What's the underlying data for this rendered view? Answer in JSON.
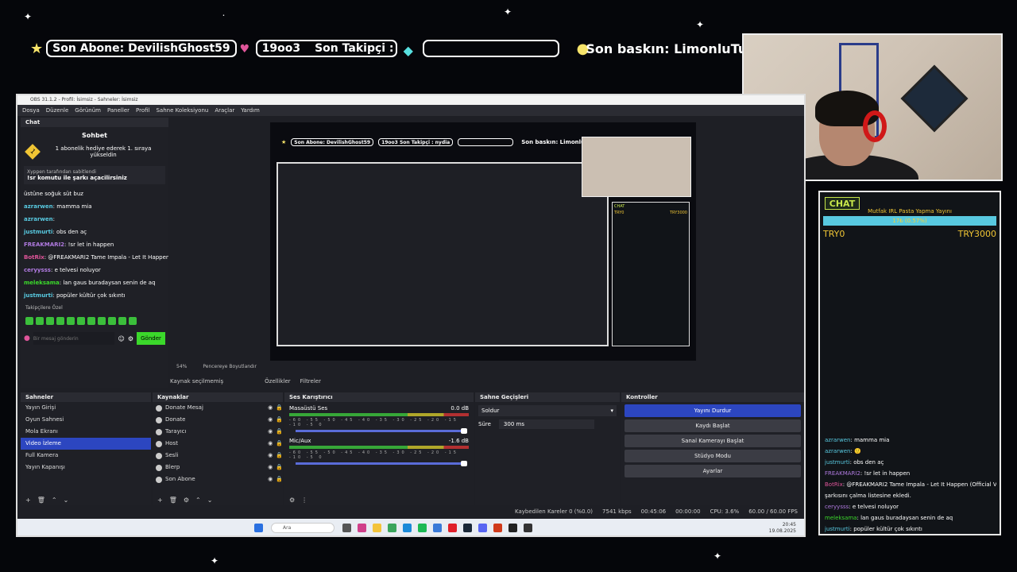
{
  "ticker": {
    "last_sub": "Son Abone: DevilishGhost59",
    "pill_2": "19oo3",
    "last_follower": "Son Takipçi : nydia",
    "empty_pill": "",
    "last_raid": "Son baskın: LimonluTurta"
  },
  "chat_overlay": {
    "label": "CHAT",
    "goal_title": "Mutfak IRL Pasta Yapma Yayını",
    "goal_progress_text": "17₺ (0.57%)",
    "goal_progress_pct": 0.57,
    "goal_min": "TRY0",
    "goal_max": "TRY3000",
    "messages": [
      {
        "user": "azrarwen",
        "text": ": mamma mia"
      },
      {
        "user": "azrarwen",
        "text": ": 🙂"
      },
      {
        "user": "justmurti",
        "text": ": obs den aç"
      },
      {
        "user": "FREAKMARI2",
        "text": ": !sr let in happen"
      },
      {
        "user": "BotRix",
        "text": ": @FREAKMARI2 Tame Impala - Let It Happen (Official Video)"
      },
      {
        "user": "",
        "text": "şarkısını çalma listesine ekledi."
      },
      {
        "user": "ceryysss",
        "text": ": e telvesi noluyor"
      },
      {
        "user": "meleksama",
        "text": ": lan gaus buradaysan senin de aq"
      },
      {
        "user": "justmurti",
        "text": ": popüler kültür çok sıkıntı"
      }
    ]
  },
  "obs": {
    "title": "OBS 31.1.2 - Profil: İsimsiz - Sahneler: İsimsiz",
    "menu": [
      "Dosya",
      "Düzenle",
      "Görünüm",
      "Paneller",
      "Profil",
      "Sahne Koleksiyonu",
      "Araçlar",
      "Yardım"
    ],
    "chat_dock": {
      "title": "Chat",
      "heading": "Sohbet",
      "gift_banner": "1 abonelik hediye ederek 1. sıraya yükseldin",
      "pinned_by": "Xyppen tarafından sabitlendi",
      "pinned_text": "!sr komutu ile şarkı açacilirsiniz",
      "messages": [
        {
          "user": "",
          "text": "üstüne soğuk süt buz"
        },
        {
          "user": "azrarwen",
          "text": ": mamma mia"
        },
        {
          "user": "azrarwen",
          "text": ":"
        },
        {
          "user": "justmurti",
          "text": ": obs den aç"
        },
        {
          "user": "FREAKMARI2",
          "text": ": !sr let in happen"
        },
        {
          "user": "BotRix",
          "text": ": @FREAKMARI2 Tame Impala - Let It Happen (Official Video) şarkısını çalma listesine ekledi."
        },
        {
          "user": "ceryysss",
          "text": ": e telvesi noluyor"
        },
        {
          "user": "meleksama",
          "text": ": lan gaus buradaysan senin de aq"
        },
        {
          "user": "justmurti",
          "text": ": popüler kültür çok sıkıntı"
        }
      ],
      "emote_section": "Takipçilere Özel",
      "input_placeholder": "Bir mesaj gönderin",
      "send_label": "Gönder"
    },
    "preview_bar": {
      "zoom": "54%",
      "fit": "Pencereye Boyutlandır"
    },
    "source_bar": {
      "no_source": "Kaynak seçilmemiş",
      "properties": "Özellikler",
      "filters": "Filtreler"
    },
    "scenes": {
      "title": "Sahneler",
      "items": [
        "Yayın Girişi",
        "Oyun Sahnesi",
        "Mola Ekranı",
        "Video İzleme",
        "Full Kamera",
        "Yayın Kapanışı"
      ],
      "selected": 3
    },
    "sources": {
      "title": "Kaynaklar",
      "items": [
        "Donate Mesaj",
        "Donate",
        "Tarayıcı",
        "Host",
        "Sesli",
        "Blerp",
        "Son Abone"
      ]
    },
    "mixer": {
      "title": "Ses Karıştırıcı",
      "channels": [
        {
          "name": "Masaüstü Ses",
          "db": "0.0 dB"
        },
        {
          "name": "Mic/Aux",
          "db": "-1.6 dB"
        }
      ],
      "ticks": "-60 -55 -50 -45 -40 -35 -30 -25 -20 -15 -10 -5 0"
    },
    "transitions": {
      "title": "Sahne Geçişleri",
      "type": "Soldur",
      "duration_label": "Süre",
      "duration": "300 ms"
    },
    "controls": {
      "title": "Kontroller",
      "buttons": [
        "Yayını Durdur",
        "Kaydı Başlat",
        "Sanal Kamerayı Başlat",
        "Stüdyo Modu",
        "Ayarlar"
      ]
    },
    "status": {
      "dropped": "Kaybedilen Kareler 0 (%0.0)",
      "bitrate": "7541 kbps",
      "stream_time": "00:45:06",
      "rec_time": "00:00:00",
      "cpu": "CPU: 3.6%",
      "fps": "60.00 / 60.00 FPS"
    },
    "taskbar": {
      "search": "Ara",
      "time": "20:45",
      "date": "19.08.2025"
    },
    "mini_preview": {
      "sub": "Son Abone: DevilishGhost59",
      "n": "19oo3",
      "follow": "Son Takipçi : nydia",
      "raid": "Son baskın: LimonluTurta",
      "chat": "CHAT",
      "try0": "TRY0",
      "try3000": "TRY3000"
    }
  },
  "colors": {
    "accent": "#2c46c0",
    "gold": "#f0c534",
    "cyan": "#58c9e0",
    "green": "#3bbf3b",
    "pink": "#e0559a"
  }
}
